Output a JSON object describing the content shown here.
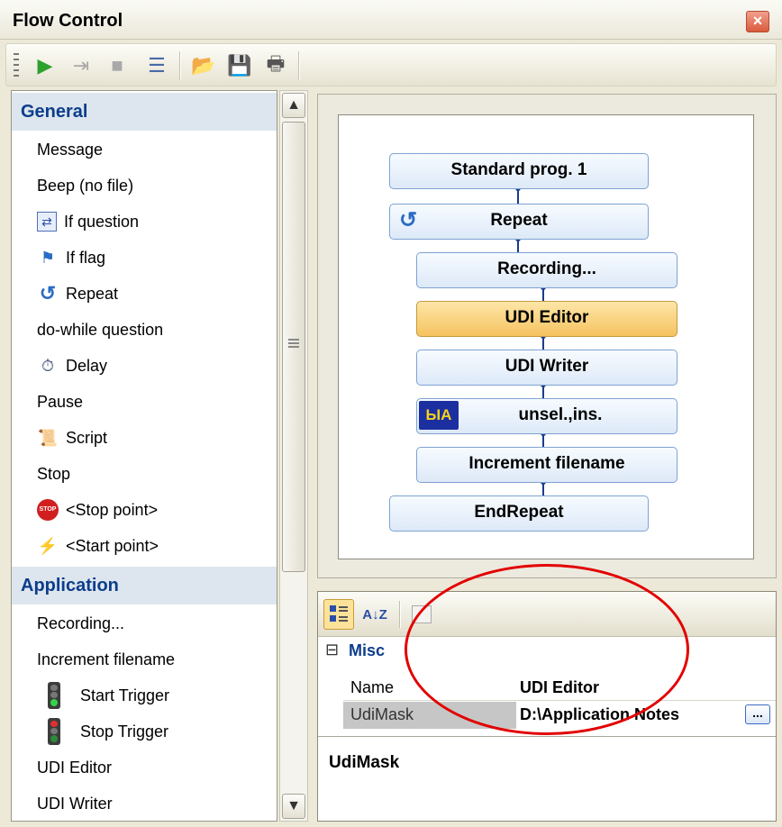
{
  "window": {
    "title": "Flow Control",
    "close_glyph": "×"
  },
  "toolbar": {
    "buttons": [
      {
        "name": "run",
        "icon": "play-icon",
        "glyph": "▶",
        "color": "#2ea02e"
      },
      {
        "name": "step",
        "icon": "step-icon",
        "glyph": "⇥",
        "color": "#a9a9a9"
      },
      {
        "name": "stop",
        "icon": "stop-icon",
        "glyph": "■",
        "color": "#a9a9a9"
      },
      {
        "name": "list",
        "icon": "list-icon",
        "glyph": "☰",
        "color": "#4a6aa6"
      },
      {
        "name": "open",
        "icon": "folder-open-icon",
        "glyph": "📂",
        "color": "#d7a431"
      },
      {
        "name": "save",
        "icon": "save-icon",
        "glyph": "💾",
        "color": "#2a5db0"
      },
      {
        "name": "print",
        "icon": "print-icon",
        "glyph": "🖶",
        "color": "#555"
      }
    ]
  },
  "library": {
    "categories": [
      {
        "label": "General"
      },
      {
        "label": "Application"
      }
    ],
    "general_items": [
      {
        "label": "Message",
        "icon": ""
      },
      {
        "label": "Beep (no file)",
        "icon": ""
      },
      {
        "label": "If question",
        "icon": "if-question-icon",
        "glyph": "⇄"
      },
      {
        "label": "If flag",
        "icon": "if-flag-icon",
        "glyph": "⚑"
      },
      {
        "label": "Repeat",
        "icon": "repeat-icon",
        "glyph": "↺"
      },
      {
        "label": "do-while question",
        "icon": ""
      },
      {
        "label": "Delay",
        "icon": "stopwatch-icon",
        "glyph": "⏱"
      },
      {
        "label": "Pause",
        "icon": ""
      },
      {
        "label": "Script",
        "icon": "script-icon",
        "glyph": "📜"
      },
      {
        "label": "Stop",
        "icon": ""
      },
      {
        "label": "<Stop point>",
        "icon": "stop-sign-icon",
        "glyph": "STOP"
      },
      {
        "label": "<Start point>",
        "icon": "lightning-icon",
        "glyph": "⚡"
      }
    ],
    "application_items": [
      {
        "label": "Recording...",
        "icon": ""
      },
      {
        "label": "Increment filename",
        "icon": ""
      },
      {
        "label": "Start Trigger",
        "icon": "traffic-light-green-icon"
      },
      {
        "label": "Stop Trigger",
        "icon": "traffic-light-red-icon"
      },
      {
        "label": "UDI Editor",
        "icon": ""
      },
      {
        "label": "UDI Writer",
        "icon": ""
      }
    ]
  },
  "scrollbar": {
    "up_glyph": "▲",
    "down_glyph": "▼"
  },
  "flow": {
    "nodes": [
      {
        "label": "Standard prog. 1",
        "selected": false
      },
      {
        "label": "Repeat",
        "selected": false,
        "icon": "repeat-icon",
        "glyph": "↺"
      },
      {
        "label": "Recording...",
        "selected": false
      },
      {
        "label": "UDI Editor",
        "selected": true
      },
      {
        "label": "UDI Writer",
        "selected": false
      },
      {
        "label": "unsel.,ins.",
        "selected": false,
        "icon": "hw-badge-icon",
        "glyph": "ЫА"
      },
      {
        "label": "Increment filename",
        "selected": false
      },
      {
        "label": "EndRepeat",
        "selected": false
      }
    ]
  },
  "properties": {
    "toolbar": {
      "categorized_icon": "categorized-icon",
      "sort_icon": "sort-az-icon",
      "sort_glyph": "A↓Z",
      "pages_icon": "property-pages-icon"
    },
    "group": {
      "label": "Misc",
      "toggle": "⊟"
    },
    "rows": [
      {
        "name": "Name",
        "value": "UDI Editor"
      },
      {
        "name": "UdiMask",
        "value": "D:\\Application Notes",
        "ellipsis": "..."
      }
    ],
    "description": "UdiMask"
  },
  "colors": {
    "category_text": "#0c3d8c",
    "selected_node": "#f5c25f",
    "annotation": "#e20000"
  }
}
